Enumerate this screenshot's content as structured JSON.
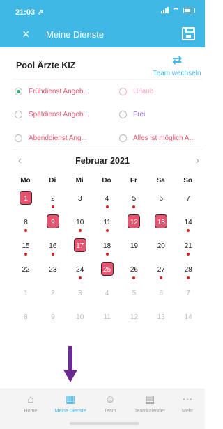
{
  "status_bar": {
    "time": "21:03 ⇗"
  },
  "app_bar": {
    "title": "Meine Dienste",
    "close_icon": "×",
    "save_icon": "save-icon"
  },
  "pool": {
    "title": "Pool Ärzte KIZ",
    "team_switch_label": "Team wechseln",
    "swap_icon": "⇄"
  },
  "options": [
    {
      "label": "Frühdienst Angeb...",
      "checked": true,
      "color": "#e85470"
    },
    {
      "label": "Urlaub",
      "checked": false,
      "color": "#f2a5bd"
    },
    {
      "label": "Spätdienst Angeb...",
      "checked": false,
      "color": "#e85470"
    },
    {
      "label": "Frei",
      "checked": false,
      "color": "#9b6bd1"
    },
    {
      "label": "Abenddienst Ang...",
      "checked": false,
      "color": "#e85470"
    },
    {
      "label": "Alles ist möglich A...",
      "checked": false,
      "color": "#e85470"
    }
  ],
  "calendar": {
    "month": "Februar 2021",
    "prev_icon": "‹",
    "next_icon": "›",
    "weekdays": [
      "Mo",
      "Di",
      "Mi",
      "Do",
      "Fr",
      "Sa",
      "So"
    ],
    "weeks": [
      [
        {
          "d": "1",
          "sel": true,
          "dot": false
        },
        {
          "d": "2",
          "dot": true
        },
        {
          "d": "3",
          "dot": false
        },
        {
          "d": "4",
          "dot": true
        },
        {
          "d": "5",
          "dot": true
        },
        {
          "d": "6",
          "dot": false
        },
        {
          "d": "7",
          "dot": false
        }
      ],
      [
        {
          "d": "8",
          "dot": true
        },
        {
          "d": "9",
          "sel": true,
          "dot": false
        },
        {
          "d": "10",
          "dot": true
        },
        {
          "d": "11",
          "dot": true
        },
        {
          "d": "12",
          "sel": true,
          "dot": false
        },
        {
          "d": "13",
          "sel": true,
          "dot": false
        },
        {
          "d": "14",
          "dot": true
        }
      ],
      [
        {
          "d": "15",
          "dot": true
        },
        {
          "d": "16",
          "dot": true
        },
        {
          "d": "17",
          "sel": true,
          "dot": false
        },
        {
          "d": "18",
          "dot": true
        },
        {
          "d": "19",
          "dot": false
        },
        {
          "d": "20",
          "dot": false
        },
        {
          "d": "21",
          "dot": true
        }
      ],
      [
        {
          "d": "22",
          "dot": false
        },
        {
          "d": "23",
          "dot": false
        },
        {
          "d": "24",
          "dot": true
        },
        {
          "d": "25",
          "sel": true,
          "dot": false
        },
        {
          "d": "26",
          "dot": true
        },
        {
          "d": "27",
          "dot": true
        },
        {
          "d": "28",
          "dot": true
        }
      ],
      [
        {
          "d": "1",
          "muted": true
        },
        {
          "d": "2",
          "muted": true
        },
        {
          "d": "3",
          "muted": true
        },
        {
          "d": "4",
          "muted": true
        },
        {
          "d": "5",
          "muted": true
        },
        {
          "d": "6",
          "muted": true
        },
        {
          "d": "7",
          "muted": true
        }
      ],
      [
        {
          "d": "8",
          "muted": true
        },
        {
          "d": "9",
          "muted": true
        },
        {
          "d": "10",
          "muted": true
        },
        {
          "d": "11",
          "muted": true
        },
        {
          "d": "12",
          "muted": true
        },
        {
          "d": "13",
          "muted": true
        },
        {
          "d": "14",
          "muted": true
        }
      ]
    ]
  },
  "tabs": [
    {
      "label": "Home",
      "icon": "⌂",
      "active": false
    },
    {
      "label": "Meine Dienste",
      "icon": "▦",
      "active": true
    },
    {
      "label": "Team",
      "icon": "☺",
      "active": false
    },
    {
      "label": "Teamkalender",
      "icon": "▤",
      "active": false
    },
    {
      "label": "Mehr",
      "icon": "⋯",
      "active": false
    }
  ],
  "colors": {
    "accent": "#3fb8e6",
    "selected_day": "#e85470",
    "dot": "#e02020",
    "arrow": "#6a2a94"
  }
}
